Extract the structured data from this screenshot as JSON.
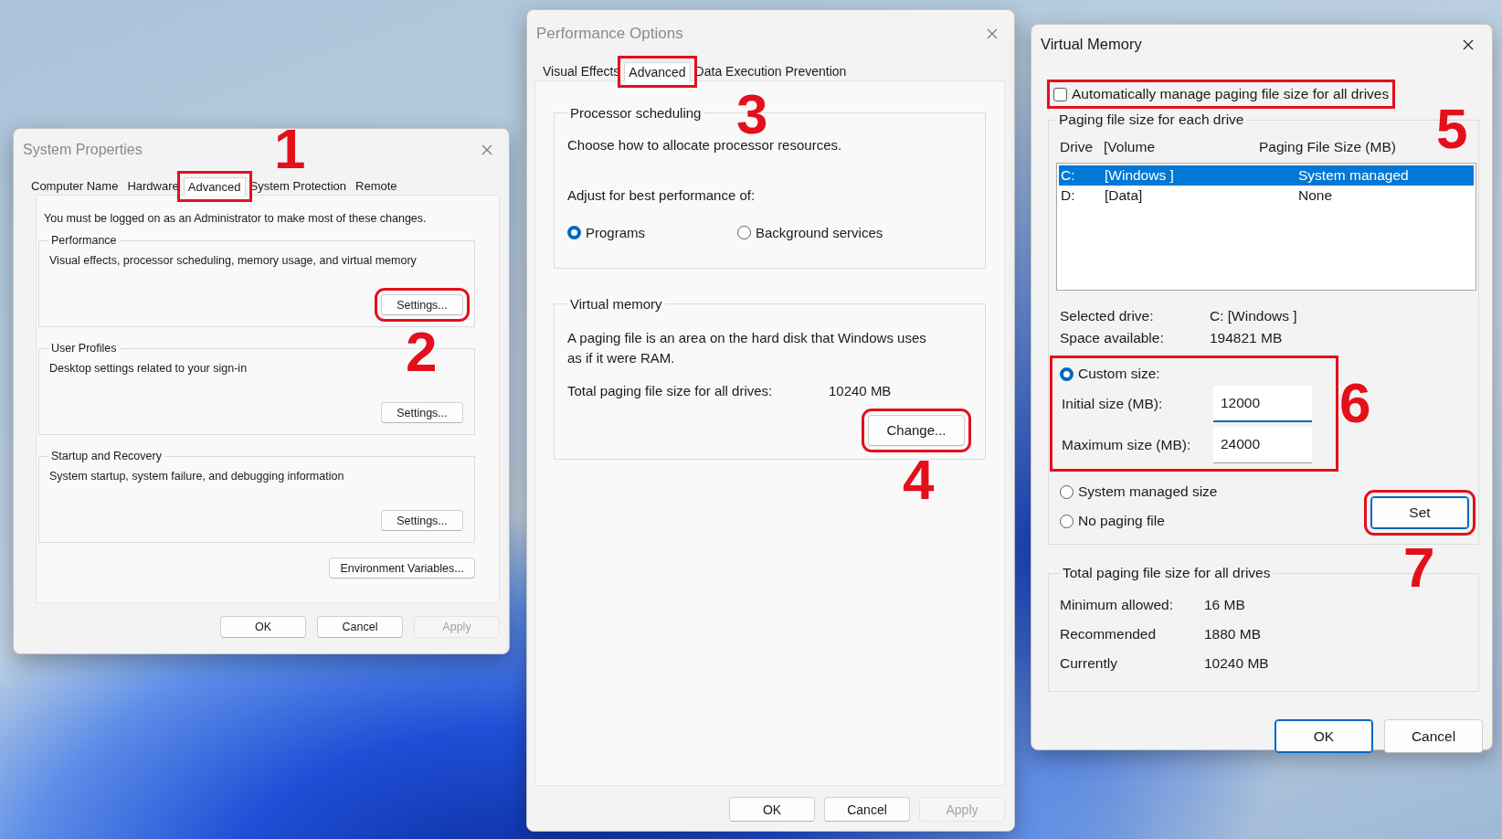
{
  "system_properties": {
    "title": "System Properties",
    "tabs": [
      {
        "label": "Computer Name",
        "selected": false
      },
      {
        "label": "Hardware",
        "selected": false
      },
      {
        "label": "Advanced",
        "selected": true,
        "callout": "1"
      },
      {
        "label": "System Protection",
        "selected": false
      },
      {
        "label": "Remote",
        "selected": false
      }
    ],
    "notice": "You must be logged on as an Administrator to make most of these changes.",
    "groups": [
      {
        "title": "Performance",
        "description": "Visual effects, processor scheduling, memory usage, and virtual memory",
        "button": {
          "label": "Settings...",
          "callout": "2"
        }
      },
      {
        "title": "User Profiles",
        "description": "Desktop settings related to your sign-in",
        "button": {
          "label": "Settings..."
        }
      },
      {
        "title": "Startup and Recovery",
        "description": "System startup, system failure, and debugging information",
        "button": {
          "label": "Settings..."
        }
      }
    ],
    "env_button": "Environment Variables...",
    "buttons": [
      {
        "label": "OK",
        "disabled": false
      },
      {
        "label": "Cancel",
        "disabled": false
      },
      {
        "label": "Apply",
        "disabled": true
      }
    ]
  },
  "performance_options": {
    "title": "Performance Options",
    "tabs": [
      {
        "label": "Visual Effects",
        "selected": false
      },
      {
        "label": "Advanced",
        "selected": true,
        "callout": "3"
      },
      {
        "label": "Data Execution Prevention",
        "selected": false
      }
    ],
    "processor_group": {
      "title": "Processor scheduling",
      "description": "Choose how to allocate processor resources.",
      "adjust_label": "Adjust for best performance of:",
      "options": [
        {
          "label": "Programs",
          "selected": true
        },
        {
          "label": "Background services",
          "selected": false
        }
      ]
    },
    "memory_group": {
      "title": "Virtual memory",
      "description": "A paging file is an area on the hard disk that Windows uses as if it were RAM.",
      "total_label": "Total paging file size for all drives:",
      "total_value": "10240 MB",
      "button": {
        "label": "Change...",
        "callout": "4"
      }
    },
    "buttons": [
      {
        "label": "OK",
        "disabled": false
      },
      {
        "label": "Cancel",
        "disabled": false
      },
      {
        "label": "Apply",
        "disabled": true
      }
    ]
  },
  "virtual_memory": {
    "title": "Virtual Memory",
    "auto_manage": {
      "label": "Automatically manage paging file size for all drives",
      "checked": false,
      "callout": "5"
    },
    "drive_group": {
      "title": "Paging file size for each drive",
      "columns": [
        "Drive",
        "[Volume",
        "Paging File Size (MB)"
      ],
      "drives": [
        {
          "drive": "C:",
          "volume": "[Windows ]",
          "size": "System managed",
          "selected": true
        },
        {
          "drive": "D:",
          "volume": "[Data]",
          "size": "None",
          "selected": false
        }
      ],
      "selected_drive_label": "Selected drive:",
      "selected_drive_value": "C:  [Windows ]",
      "space_label": "Space available:",
      "space_value": "194821 MB",
      "custom_size": {
        "label": "Custom size:",
        "selected": true,
        "callout": "6",
        "initial_label": "Initial size (MB):",
        "initial_value": "12000",
        "maximum_label": "Maximum size (MB):",
        "maximum_value": "24000"
      },
      "other_options": [
        {
          "label": "System managed size",
          "selected": false
        },
        {
          "label": "No paging file",
          "selected": false
        }
      ],
      "set_button": {
        "label": "Set",
        "callout": "7"
      }
    },
    "totals": {
      "title": "Total paging file size for all drives",
      "rows": [
        {
          "label": "Minimum allowed:",
          "value": "16 MB"
        },
        {
          "label": "Recommended",
          "value": "1880 MB"
        },
        {
          "label": "Currently",
          "value": "10240 MB"
        }
      ]
    },
    "buttons": [
      {
        "label": "OK",
        "default": true
      },
      {
        "label": "Cancel",
        "default": false
      }
    ]
  }
}
